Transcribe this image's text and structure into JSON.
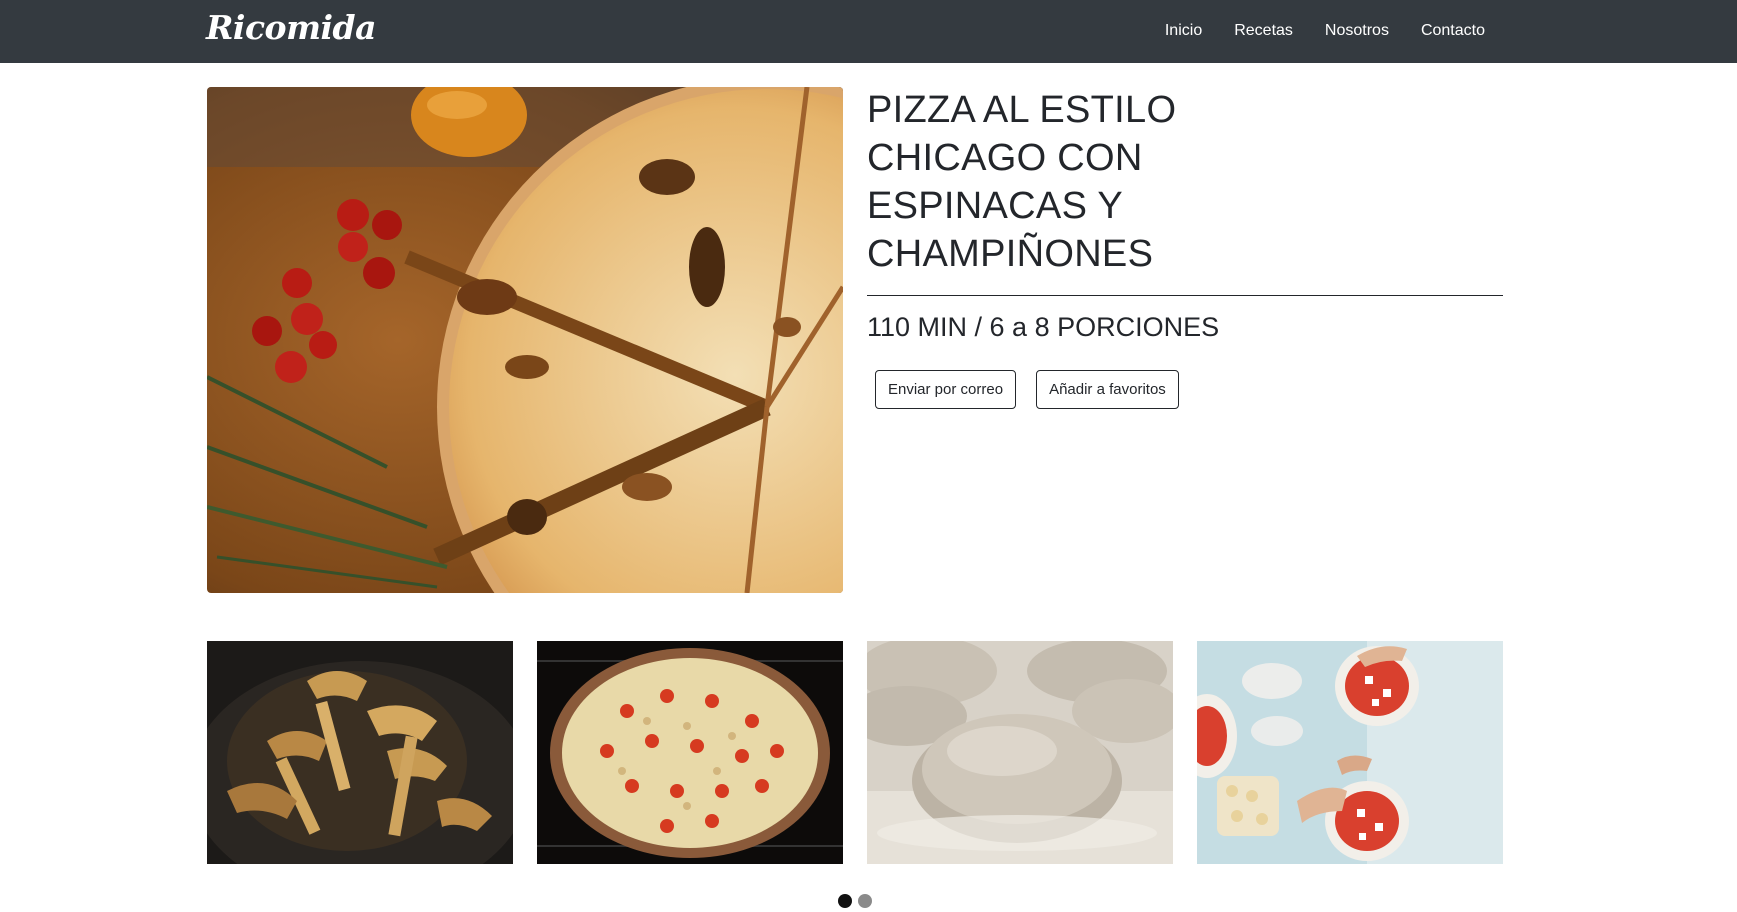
{
  "navbar": {
    "brand": "Ricomida",
    "links": [
      {
        "label": "Inicio"
      },
      {
        "label": "Recetas"
      },
      {
        "label": "Nosotros"
      },
      {
        "label": "Contacto"
      }
    ],
    "background": "#343a40"
  },
  "recipe": {
    "title": "PIZZA AL ESTILO CHICAGO CON ESPINACAS Y CHAMPIÑONES",
    "meta": "110 MIN / 6 a 8 PORCIONES",
    "actions": {
      "email": "Enviar por correo",
      "favorite": "Añadir a favoritos"
    }
  },
  "gallery": {
    "images": [
      "mushrooms-photo",
      "baked-pizza-photo",
      "dough-ball-photo",
      "pizza-prep-photo"
    ],
    "carousel_dots": [
      {
        "active": true,
        "color": "#111111"
      },
      {
        "active": false,
        "color": "#8a8a8a"
      }
    ]
  }
}
